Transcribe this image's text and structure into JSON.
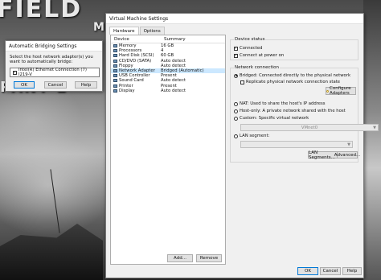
{
  "background": {
    "poster_top": "FIELD",
    "poster_mid": "PANY 2",
    "poster_right": "MA"
  },
  "bridge_dialog": {
    "title": "Automatic Bridging Settings",
    "prompt": "Select the host network adapter(s) you want to automatically bridge:",
    "adapter": {
      "label": "Intel(R) Ethernet Connection (7) I219-V",
      "checked": true
    },
    "ok_label": "OK",
    "cancel_label": "Cancel",
    "help_label": "Help"
  },
  "vm_settings": {
    "title": "Virtual Machine Settings",
    "tabs": [
      {
        "label": "Hardware",
        "active": true
      },
      {
        "label": "Options",
        "active": false
      }
    ],
    "hardware_headers": {
      "device": "Device",
      "summary": "Summary"
    },
    "hardware": [
      {
        "device": "Memory",
        "summary": "16 GB",
        "icon": "memory-icon"
      },
      {
        "device": "Processors",
        "summary": "4",
        "icon": "processor-icon"
      },
      {
        "device": "Hard Disk (SCSI)",
        "summary": "60 GB",
        "icon": "hard-disk-icon"
      },
      {
        "device": "CD/DVD (SATA)",
        "summary": "Auto detect",
        "icon": "cd-dvd-icon"
      },
      {
        "device": "Floppy",
        "summary": "Auto detect",
        "icon": "floppy-icon"
      },
      {
        "device": "Network Adapter",
        "summary": "Bridged (Automatic)",
        "icon": "network-adapter-icon",
        "selected": true
      },
      {
        "device": "USB Controller",
        "summary": "Present",
        "icon": "usb-icon"
      },
      {
        "device": "Sound Card",
        "summary": "Auto detect",
        "icon": "sound-card-icon"
      },
      {
        "device": "Printer",
        "summary": "Present",
        "icon": "printer-icon"
      },
      {
        "device": "Display",
        "summary": "Auto detect",
        "icon": "display-icon"
      }
    ],
    "add_label": "Add...",
    "remove_label": "Remove",
    "device_status": {
      "title": "Device status",
      "connected": {
        "label": "Connected",
        "checked": true
      },
      "connect_power_on": {
        "label": "Connect at power on",
        "checked": true
      }
    },
    "network_connection": {
      "title": "Network connection",
      "bridged": {
        "label": "Bridged: Connected directly to the physical network",
        "selected": true
      },
      "replicate": {
        "label": "Replicate physical network connection state",
        "checked": false
      },
      "configure_adapters_label": "Configure Adapters",
      "nat": {
        "label": "NAT: Used to share the host's IP address",
        "selected": false
      },
      "host_only": {
        "label": "Host-only: A private network shared with the host",
        "selected": false
      },
      "custom": {
        "label": "Custom: Specific virtual network",
        "selected": false
      },
      "custom_vmnet": "VMnet0",
      "lan_segment": {
        "label": "LAN segment:",
        "selected": false
      },
      "lan_segments_label": "LAN Segments...",
      "advanced_label": "Advanced..."
    },
    "ok_label": "OK",
    "cancel_label": "Cancel",
    "help_label": "Help"
  }
}
